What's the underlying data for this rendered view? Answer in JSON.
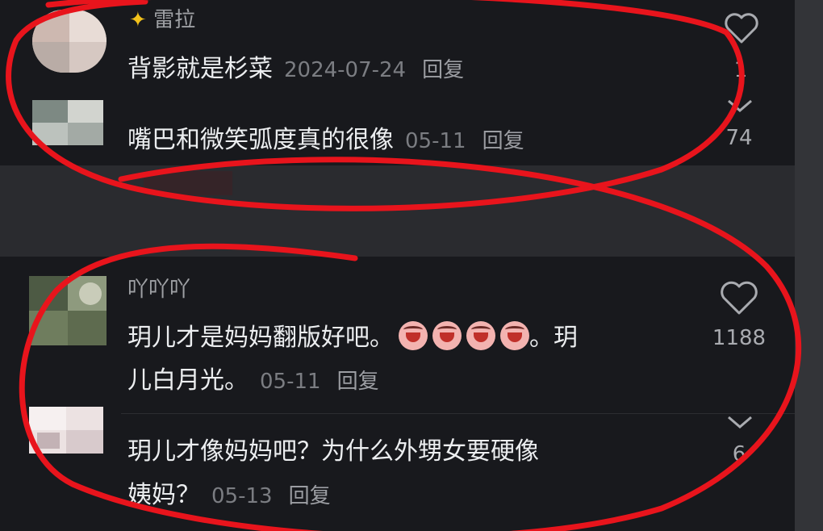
{
  "comments": [
    {
      "username": "雷拉",
      "text": "背影就是杉菜",
      "date": "2024-07-24",
      "reply_label": "回复",
      "like_count": "1",
      "avatar_colors": [
        "#d9c8c2",
        "#b9b1ac",
        "#efe7e2"
      ]
    },
    {
      "username": "",
      "text": "嘴巴和微笑弧度真的很像",
      "date": "05-11",
      "reply_label": "回复",
      "like_count": "74",
      "avatar_colors": [
        "#9fa8a2",
        "#c8cbc6",
        "#7a8680"
      ]
    },
    {
      "username": "吖吖吖",
      "text_line1": "玥儿才是妈妈翻版好吧。",
      "text_line1_suffix": "。玥",
      "text_line2": "儿白月光。",
      "date": "05-11",
      "reply_label": "回复",
      "like_count": "1188",
      "avatar_colors": [
        "#6f7d5e",
        "#9aa48a",
        "#4b5441"
      ]
    },
    {
      "username": "",
      "text_line1": "玥儿才像妈妈吧？为什么外甥女要硬像",
      "text_line2": "姨妈？",
      "date": "05-13",
      "reply_label": "回复",
      "like_count": "6",
      "avatar_colors": [
        "#e8dcdc",
        "#f5eeee",
        "#d3c4c6"
      ]
    }
  ],
  "colors": {
    "annotation_red": "#e8141c",
    "panel_bg": "#18191d",
    "page_bg": "#2a2b2f"
  },
  "icons": [
    "heart-icon",
    "chevron-down-icon"
  ]
}
